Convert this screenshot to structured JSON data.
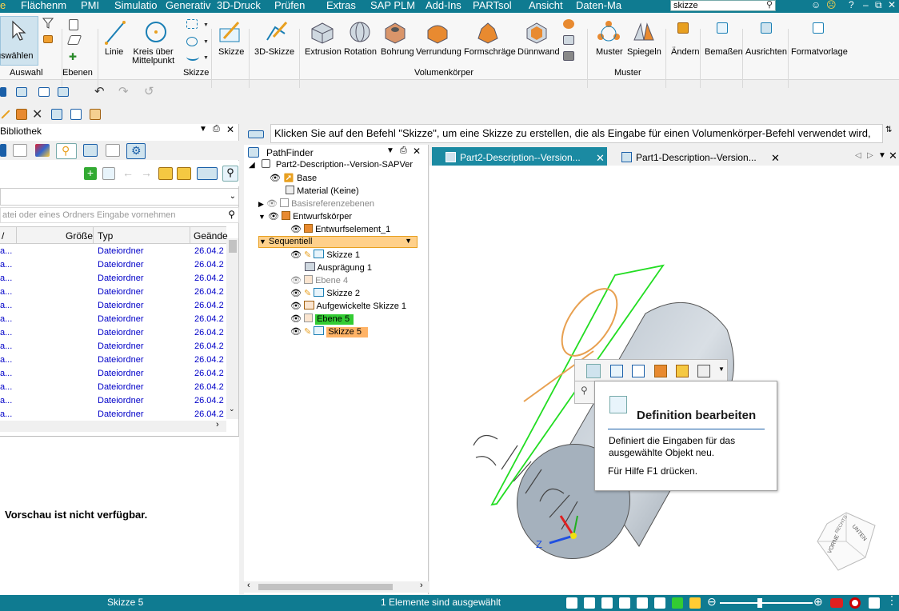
{
  "menubar": {
    "first_tab": "e",
    "items": [
      "Flächenm",
      "PMI",
      "Simulatio",
      "Generativ",
      "3D-Druck",
      "Prüfen",
      "Extras",
      "SAP PLM",
      "Add-Ins",
      "PARTsol",
      "Ansicht",
      "Daten-Ma"
    ],
    "search_value": "skizze",
    "window_buttons": [
      "?",
      "–",
      "⧉"
    ]
  },
  "ribbon": {
    "buttons": {
      "auswaehlen": "uswählen",
      "linie": "Linie",
      "kreis": "Kreis über\nMittelpunkt",
      "skizze": "Skizze",
      "skizze3d": "3D-Skizze",
      "extrusion": "Extrusion",
      "rotation": "Rotation",
      "bohrung": "Bohrung",
      "verrundung": "Verrundung",
      "formschraege": "Formschräge",
      "duennwand": "Dünnwand",
      "muster": "Muster",
      "spiegeln": "Spiegeln",
      "aendern": "Ändern",
      "bemassen": "Bemaßen",
      "ausrichten": "Ausrichten",
      "formatvorlage": "Formatvorlage"
    },
    "groups": [
      "Auswahl",
      "Ebenen",
      "Skizze",
      "Volumenkörper",
      "Muster"
    ]
  },
  "library": {
    "title": "Bibliothek",
    "search_placeholder": "atei oder eines Ordners Eingabe vornehmen",
    "columns": [
      "/",
      "Größe",
      "Typ",
      "Geände"
    ],
    "rows": [
      {
        "name": "a...",
        "type": "Dateiordner",
        "date": "26.04.2"
      },
      {
        "name": "a...",
        "type": "Dateiordner",
        "date": "26.04.2"
      },
      {
        "name": "a...",
        "type": "Dateiordner",
        "date": "26.04.2"
      },
      {
        "name": "a...",
        "type": "Dateiordner",
        "date": "26.04.2"
      },
      {
        "name": "a...",
        "type": "Dateiordner",
        "date": "26.04.2"
      },
      {
        "name": "a...",
        "type": "Dateiordner",
        "date": "26.04.2"
      },
      {
        "name": "a...",
        "type": "Dateiordner",
        "date": "26.04.2"
      },
      {
        "name": "a...",
        "type": "Dateiordner",
        "date": "26.04.2"
      },
      {
        "name": "a...",
        "type": "Dateiordner",
        "date": "26.04.2"
      },
      {
        "name": "a...",
        "type": "Dateiordner",
        "date": "26.04.2"
      },
      {
        "name": "a...",
        "type": "Dateiordner",
        "date": "26.04.2"
      },
      {
        "name": "a...",
        "type": "Dateiordner",
        "date": "26.04.2"
      },
      {
        "name": "a...",
        "type": "Dateiordner",
        "date": "26.04.2"
      }
    ],
    "preview_text": "Vorschau ist nicht verfügbar."
  },
  "command_text": "Klicken Sie auf den Befehl \"Skizze\", um eine Skizze zu erstellen, die als Eingabe für einen Volumenkörper-Befehl verwendet wird,",
  "pathfinder": {
    "title": "PathFinder",
    "root": "Part2-Description--Version-SAPVer",
    "nodes": {
      "base": "Base",
      "material": "Material (Keine)",
      "basisref": "Basisreferenzebenen",
      "entwurf": "Entwurfskörper",
      "entwurfselement": "Entwurfselement_1",
      "sequentiell": "Sequentiell",
      "skizze1": "Skizze 1",
      "auspraegung": "Ausprägung 1",
      "ebene4": "Ebene 4",
      "skizze2": "Skizze 2",
      "aufgewickelt": "Aufgewickelte Skizze 1",
      "ebene5": "Ebene 5",
      "skizze5": "Skizze 5"
    }
  },
  "doc_tabs": [
    "Part2-Description--Version...",
    "Part1-Description--Version..."
  ],
  "tooltip": {
    "title": "Definition bearbeiten",
    "description": "Definiert die Eingaben für das ausgewählte Objekt neu.",
    "help": "Für Hilfe F1 drücken."
  },
  "viewcube": {
    "top": "UNTEN",
    "front": "VORNE",
    "side": "RECHTS"
  },
  "status": {
    "left": "Skizze 5",
    "center": "1 Elemente sind ausgewählt"
  },
  "colors": {
    "accent": "#0f7b91",
    "tab_active": "#1b8aa2",
    "highlight_green": "#33cc33",
    "highlight_orange": "#ffb366"
  }
}
